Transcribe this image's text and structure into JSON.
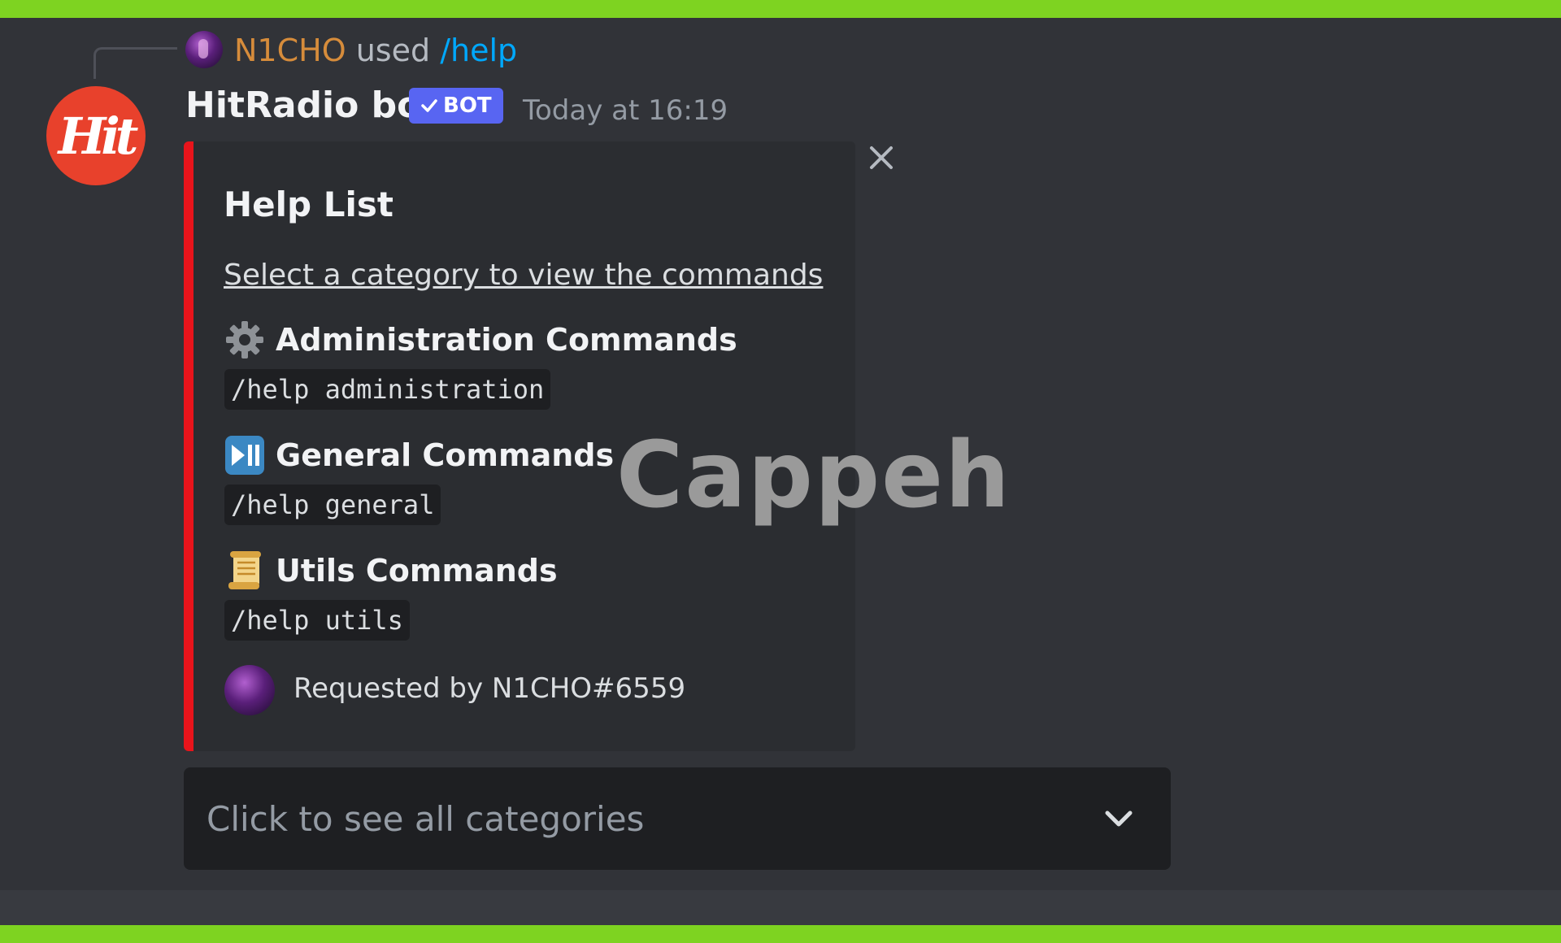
{
  "reply": {
    "user": "N1CHO",
    "used": "used",
    "command": "/help"
  },
  "message": {
    "username": "HitRadio bot",
    "badge": "BOT",
    "timestamp": "Today at 16:19",
    "avatar_text": "Hit"
  },
  "embed": {
    "accent_color": "#e8141b",
    "title": "Help List",
    "description": "Select a category to view the commands",
    "fields": [
      {
        "icon": "gear-icon",
        "name": "Administration Commands",
        "value": "/help administration"
      },
      {
        "icon": "play-pause-icon",
        "name": "General Commands",
        "value": "/help general"
      },
      {
        "icon": "scroll-icon",
        "name": "Utils Commands",
        "value": "/help utils"
      }
    ],
    "footer": "Requested by N1CHO#6559"
  },
  "select": {
    "placeholder": "Click to see all categories"
  },
  "watermark": "Cappeh",
  "colors": {
    "background": "#313338",
    "frame": "#7ed321",
    "bot_badge": "#5865f2",
    "reply_user": "#d68c3b",
    "reply_command": "#00a8fc"
  }
}
